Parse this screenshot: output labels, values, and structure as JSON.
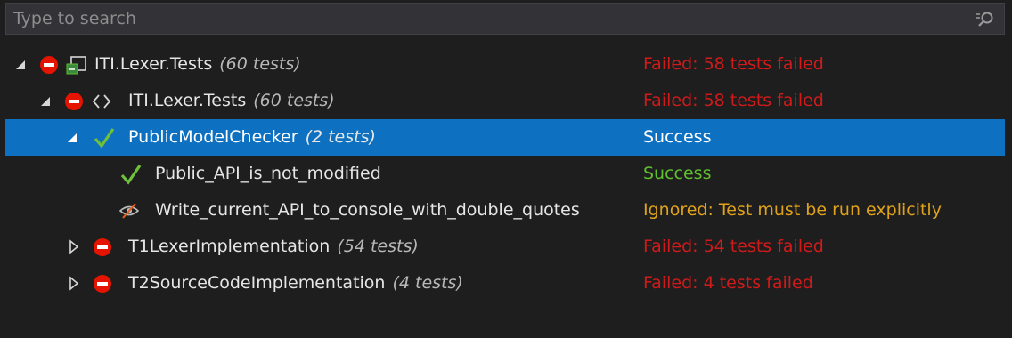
{
  "search": {
    "placeholder": "Type to search",
    "value": ""
  },
  "tree": [
    {
      "name": "ITI.Lexer.Tests",
      "count": "(60 tests)",
      "status": "Failed: 58 tests failed",
      "status_color": "#d11a1a",
      "state": "failed",
      "level": 0,
      "expanded": true,
      "type_icon": "test-project-icon"
    },
    {
      "name": "ITI.Lexer.Tests",
      "count": "(60 tests)",
      "status": "Failed: 58 tests failed",
      "status_color": "#d11a1a",
      "state": "failed",
      "level": 1,
      "expanded": true,
      "type_icon": "namespace-icon"
    },
    {
      "name": "PublicModelChecker",
      "count": "(2 tests)",
      "status": "Success",
      "status_color": "#ffffff",
      "state": "success",
      "level": 2,
      "expanded": true,
      "selected": true
    },
    {
      "name": "Public_API_is_not_modified",
      "count": "",
      "status": "Success",
      "status_color": "#5fbf2f",
      "state": "success",
      "level": 3
    },
    {
      "name": "Write_current_API_to_console_with_double_quotes",
      "count": "",
      "status": "Ignored: Test must be run explicitly",
      "status_color": "#e0a21a",
      "state": "ignored",
      "level": 3
    },
    {
      "name": "T1LexerImplementation",
      "count": "(54 tests)",
      "status": "Failed: 54 tests failed",
      "status_color": "#d11a1a",
      "state": "failed",
      "level": 2,
      "expanded": false
    },
    {
      "name": "T2SourceCodeImplementation",
      "count": "(4 tests)",
      "status": "Failed: 4 tests failed",
      "status_color": "#d11a1a",
      "state": "failed",
      "level": 2,
      "expanded": false
    }
  ]
}
